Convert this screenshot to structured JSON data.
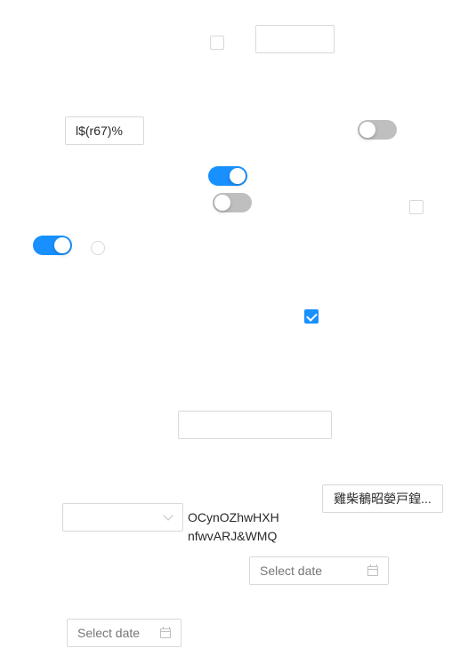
{
  "form": {
    "checkbox_1": {
      "checked": false
    },
    "text_input_1": {
      "value": ""
    },
    "text_input_2": {
      "value": "l$(r67)%"
    },
    "switch_1": {
      "on": false
    },
    "switch_2": {
      "on": true
    },
    "switch_3": {
      "on": false
    },
    "checkbox_2": {
      "checked": false
    },
    "switch_4": {
      "on": true
    },
    "radio_1": {
      "checked": false
    },
    "checkbox_3": {
      "checked": true
    },
    "text_input_3": {
      "value": ""
    },
    "button_1": {
      "label": "雞柴鶺昭嫈戸鍠..."
    },
    "select_1": {
      "value": ""
    },
    "text_block": {
      "line_1": "OCynOZhwHXH",
      "line_2": "nfwvARJ&WMQ"
    },
    "date_picker_1": {
      "placeholder": "Select date"
    },
    "date_picker_2": {
      "placeholder": "Select date"
    }
  },
  "colors": {
    "primary": "#1890ff",
    "switch_off": "#bfbfbf",
    "border": "#d9d9d9"
  },
  "icons": [
    "check-icon",
    "chevron-down-icon",
    "calendar-icon"
  ]
}
